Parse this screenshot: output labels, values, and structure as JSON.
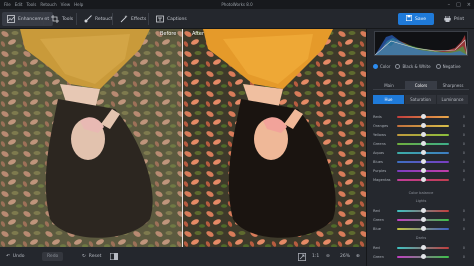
{
  "menu": {
    "items": [
      "File",
      "Edit",
      "Tools",
      "Retouch",
      "View",
      "Help"
    ],
    "app_title": "PhotoWorks 8.0"
  },
  "toolbar": {
    "enhancement": "Enhancement",
    "tools": "Tools",
    "retouch": "Retouch",
    "effects": "Effects",
    "captions": "Captions",
    "save": "Save",
    "print": "Print"
  },
  "canvas": {
    "before_label": "Before",
    "after_label": "After"
  },
  "statusbar": {
    "undo": "Undo",
    "redo": "Redo",
    "reset": "Reset",
    "ratio": "1:1",
    "zoom": "26%"
  },
  "panel": {
    "histogram_colors": [
      "#e04a4a",
      "#3fb84a",
      "#2f6fe0",
      "#d8d8d8"
    ],
    "color_mode": {
      "options": [
        "Color",
        "Black & White",
        "Negative"
      ],
      "selected": "Color"
    },
    "tabs_primary": {
      "items": [
        "Main",
        "Colors",
        "Sharpness"
      ],
      "selected": "Colors"
    },
    "tabs_secondary": {
      "items": [
        "Hue",
        "Saturation",
        "Luminance"
      ],
      "selected": "Hue"
    },
    "hue_sliders": [
      {
        "label": "Reds",
        "value": "0",
        "level": 0.5,
        "colors": [
          "#c23d3d",
          "#e8a84a"
        ]
      },
      {
        "label": "Oranges",
        "value": "0",
        "level": 0.5,
        "colors": [
          "#c2703d",
          "#d8c04a"
        ]
      },
      {
        "label": "Yellows",
        "value": "0",
        "level": 0.5,
        "colors": [
          "#c29a3d",
          "#8bbf3d"
        ]
      },
      {
        "label": "Greens",
        "value": "0",
        "level": 0.5,
        "colors": [
          "#6fae3d",
          "#3dae8a"
        ]
      },
      {
        "label": "Aquas",
        "value": "0",
        "level": 0.5,
        "colors": [
          "#3daea8",
          "#3d7bc2"
        ]
      },
      {
        "label": "Blues",
        "value": "0",
        "level": 0.5,
        "colors": [
          "#3d6fc2",
          "#7a3dc2"
        ]
      },
      {
        "label": "Purples",
        "value": "0",
        "level": 0.5,
        "colors": [
          "#7a3dc2",
          "#c23da8"
        ]
      },
      {
        "label": "Magentas",
        "value": "0",
        "level": 0.5,
        "colors": [
          "#c23d9a",
          "#c23d4f"
        ]
      }
    ],
    "color_balance_label": "Color balance",
    "lights_label": "Lights",
    "lights_sliders": [
      {
        "label": "Red",
        "value": "0",
        "level": 0.5,
        "colors": [
          "#3dc2c2",
          "#c23d3d"
        ]
      },
      {
        "label": "Green",
        "value": "0",
        "level": 0.5,
        "colors": [
          "#c23dc2",
          "#3dc24a"
        ]
      },
      {
        "label": "Blue",
        "value": "0",
        "level": 0.5,
        "colors": [
          "#c2c23d",
          "#3d5ec2"
        ]
      }
    ],
    "darks_label": "Darks",
    "darks_sliders": [
      {
        "label": "Red",
        "value": "0",
        "level": 0.5,
        "colors": [
          "#3dc2c2",
          "#c23d3d"
        ]
      },
      {
        "label": "Green",
        "value": "0",
        "level": 0.5,
        "colors": [
          "#c23dc2",
          "#3dc24a"
        ]
      }
    ]
  }
}
